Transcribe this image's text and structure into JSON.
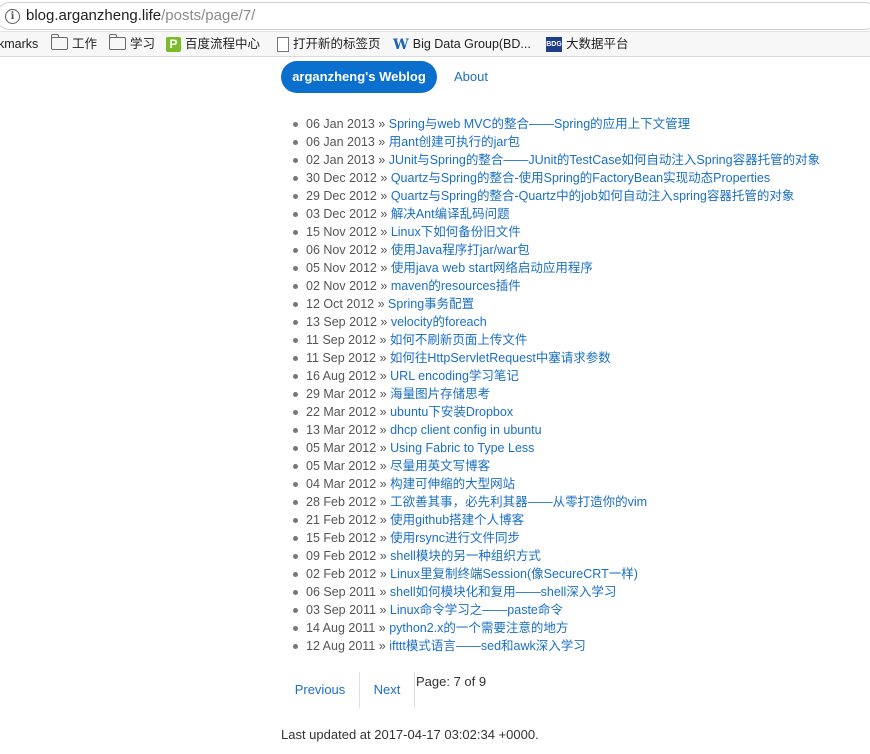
{
  "browser": {
    "url_host": "blog.arganzheng.life",
    "url_path": "/posts/page/7/",
    "bookmarks": [
      {
        "label": "kmarks",
        "icon": "none"
      },
      {
        "label": "工作",
        "icon": "folder-icon"
      },
      {
        "label": "学习",
        "icon": "folder-icon"
      },
      {
        "label": "百度流程中心",
        "icon": "p-logo-icon"
      },
      {
        "label": "打开新的标签页",
        "icon": "page-icon"
      },
      {
        "label": "Big Data Group(BD...",
        "icon": "w-logo-icon"
      },
      {
        "label": "大数据平台",
        "icon": "bdg-logo-icon"
      }
    ]
  },
  "nav": {
    "brand": "arganzheng's Weblog",
    "about": "About"
  },
  "posts": [
    {
      "date": "06 Jan 2013",
      "title": "Spring与web MVC的整合——Spring的应用上下文管理"
    },
    {
      "date": "06 Jan 2013",
      "title": "用ant创建可执行的jar包"
    },
    {
      "date": "02 Jan 2013",
      "title": "JUnit与Spring的整合——JUnit的TestCase如何自动注入Spring容器托管的对象"
    },
    {
      "date": "30 Dec 2012",
      "title": "Quartz与Spring的整合-使用Spring的FactoryBean实现动态Properties"
    },
    {
      "date": "29 Dec 2012",
      "title": "Quartz与Spring的整合-Quartz中的job如何自动注入spring容器托管的对象"
    },
    {
      "date": "03 Dec 2012",
      "title": "解决Ant编译乱码问题"
    },
    {
      "date": "15 Nov 2012",
      "title": "Linux下如何备份旧文件"
    },
    {
      "date": "06 Nov 2012",
      "title": "使用Java程序打jar/war包"
    },
    {
      "date": "05 Nov 2012",
      "title": "使用java web start网络启动应用程序"
    },
    {
      "date": "02 Nov 2012",
      "title": "maven的resources插件"
    },
    {
      "date": "12 Oct 2012",
      "title": "Spring事务配置"
    },
    {
      "date": "13 Sep 2012",
      "title": "velocity的foreach"
    },
    {
      "date": "11 Sep 2012",
      "title": "如何不刷新页面上传文件"
    },
    {
      "date": "11 Sep 2012",
      "title": "如何往HttpServletRequest中塞请求参数"
    },
    {
      "date": "16 Aug 2012",
      "title": "URL encoding学习笔记"
    },
    {
      "date": "29 Mar 2012",
      "title": "海量图片存储思考"
    },
    {
      "date": "22 Mar 2012",
      "title": "ubuntu下安装Dropbox"
    },
    {
      "date": "13 Mar 2012",
      "title": "dhcp client config in ubuntu"
    },
    {
      "date": "05 Mar 2012",
      "title": "Using Fabric to Type Less"
    },
    {
      "date": "05 Mar 2012",
      "title": "尽量用英文写博客"
    },
    {
      "date": "04 Mar 2012",
      "title": "构建可伸缩的大型网站"
    },
    {
      "date": "28 Feb 2012",
      "title": "工欲善其事，必先利其器——从零打造你的vim"
    },
    {
      "date": "21 Feb 2012",
      "title": "使用github搭建个人博客"
    },
    {
      "date": "15 Feb 2012",
      "title": "使用rsync进行文件同步"
    },
    {
      "date": "09 Feb 2012",
      "title": "shell模块的另一种组织方式"
    },
    {
      "date": "02 Feb 2012",
      "title": "Linux里复制终端Session(像SecureCRT一样)"
    },
    {
      "date": "06 Sep 2011",
      "title": "shell如何模块化和复用——shell深入学习"
    },
    {
      "date": "03 Sep 2011",
      "title": "Linux命令学习之——paste命令"
    },
    {
      "date": "14 Aug 2011",
      "title": "python2.x的一个需要注意的地方"
    },
    {
      "date": "12 Aug 2011",
      "title": "ifttt模式语言——sed和awk深入学习"
    }
  ],
  "separator": "»",
  "pager": {
    "previous": "Previous",
    "next": "Next",
    "info": "Page: 7 of 9"
  },
  "footer": "Last updated at 2017-04-17 03:02:34 +0000."
}
